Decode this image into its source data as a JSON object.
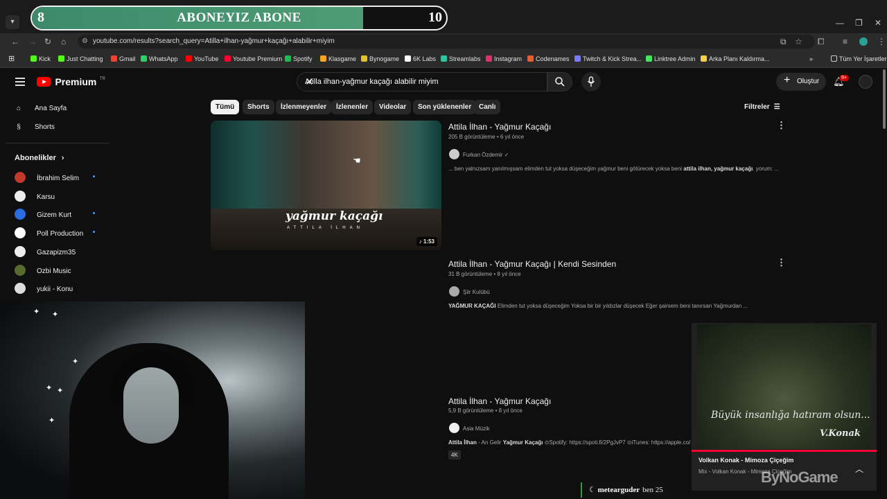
{
  "overlay": {
    "left_count": "8",
    "text": "ABONEYIZ ABONE",
    "right_count": "10",
    "progress": 0.8
  },
  "browser": {
    "url": "youtube.com/results?search_query=Atilla+ilhan-yağmur+kaçağı+alabilir+miyim",
    "bookmarks": [
      "Kick",
      "Just Chatting",
      "Gmail",
      "WhatsApp",
      "YouTube",
      "Youtube Premium",
      "Spotify",
      "Klasgame",
      "Bynogame",
      "6K Labs",
      "Streamlabs",
      "Instagram",
      "Codenames",
      "Twitch & Kick Strea...",
      "Linktree Admin",
      "Arka Planı Kaldırma..."
    ],
    "bookmark_colors": [
      "#53fc18",
      "#53fc18",
      "#ea4335",
      "#25d366",
      "#ff0000",
      "#ff0033",
      "#1db954",
      "#f5a623",
      "#e6c229",
      "#ffffff",
      "#31c3a2",
      "#e1306c",
      "#e85d2c",
      "#7a7aff",
      "#43e55e",
      "#f7d046"
    ],
    "all_bookmarks": "Tüm Yer İşaretleri"
  },
  "youtube": {
    "logo": "Premium",
    "region": "TR",
    "search_value": "Atilla ilhan-yağmur kaçağı alabilir miyim",
    "create_label": "Oluştur",
    "notif_badge": "9+",
    "nav": [
      {
        "label": "Ana Sayfa",
        "icon": "home-icon"
      },
      {
        "label": "Shorts",
        "icon": "shorts-icon"
      }
    ],
    "subs_header": "Abonelikler",
    "subscriptions": [
      {
        "name": "İbrahim Selim",
        "dot": true,
        "color": "#c0392b"
      },
      {
        "name": "Karsu",
        "dot": false,
        "color": "#eeeeee"
      },
      {
        "name": "Gizem Kurt",
        "dot": true,
        "color": "#2d6cdf"
      },
      {
        "name": "Poll Production",
        "dot": true,
        "color": "#ffffff"
      },
      {
        "name": "Gazapizm35",
        "dot": false,
        "color": "#eeeeee"
      },
      {
        "name": "Ozbi Music",
        "dot": false,
        "color": "#556b2f"
      },
      {
        "name": "yukii - Konu",
        "dot": false,
        "color": "#dddddd"
      }
    ],
    "chips": [
      "Tümü",
      "Shorts",
      "İzlenmeyenler",
      "İzlenenler",
      "Videolar",
      "Son yüklenenler",
      "Canlı"
    ],
    "filters_label": "Filtreler",
    "results": [
      {
        "title": "Attila İlhan - Yağmur Kaçağı",
        "meta": "205 B görüntüleme • 6 yıl önce",
        "channel": "Furkan Özdemir",
        "verified": true,
        "desc_pre": "... ben yalnızsam yanılmışsam elimden tut yoksa düşeceğim yağmur beni götürecek yoksa beni ",
        "desc_bold": "attila ilhan, yağmur kaçağı",
        "desc_post": ". yorum: ...",
        "duration": "1:53",
        "thumb_title": "yağmur kaçağı",
        "thumb_sub": "ATTILA İLHAN"
      },
      {
        "title": "Attila İlhan - Yağmur Kaçağı | Kendi Sesinden",
        "meta": "31 B görüntüleme • 8 yıl önce",
        "channel": "Şiir Kulübü",
        "verified": false,
        "desc_bold": "YAĞMUR KAÇAĞI",
        "desc_post": " Elimden tut yoksa düşeceğim Yoksa bir bir yıldızlar düşecek Eğer şairsem beni tanırsan Yağmurdan ..."
      },
      {
        "title": "Attila İlhan - Yağmur Kaçağı",
        "meta": "5,9 B görüntüleme • 8 yıl önce",
        "channel": "Asia Müzik",
        "verified": false,
        "desc_bold": "Attila İlhan",
        "desc_mid": " - An Gelir ",
        "desc_bold2": "Yağmur Kaçağı",
        "desc_post": " ⊙Spotify: https://spoti.fi/2PgJvP7 ⊙iTunes: https://apple.co/2l",
        "badge": "4K"
      }
    ],
    "miniplayer": {
      "quote": "Büyük insanlığa hatıram olsun...",
      "sign": "V.Konak",
      "title": "Volkan Konak - Mimoza Çiçeğim",
      "subtitle": "Mix - Volkan Konak - Mimoza Çiçeğim"
    }
  },
  "stream": {
    "watermark": "ByNoGame",
    "chat_user": "metearguder",
    "chat_msg": "ben 25"
  }
}
